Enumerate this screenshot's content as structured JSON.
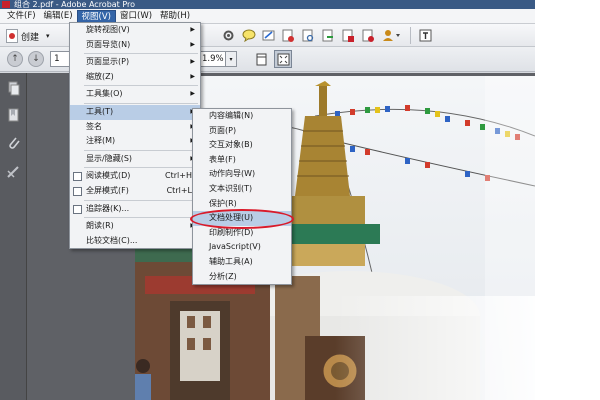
{
  "window": {
    "title": "组合 2.pdf - Adobe Acrobat Pro"
  },
  "menubar": {
    "items": [
      {
        "label": "文件(F)",
        "active": false
      },
      {
        "label": "编辑(E)",
        "active": false
      },
      {
        "label": "视图(V)",
        "active": true
      },
      {
        "label": "窗口(W)",
        "active": false
      },
      {
        "label": "帮助(H)",
        "active": false
      }
    ]
  },
  "toolbar": {
    "create_label": "创建",
    "create_arrow": "▾"
  },
  "navbar": {
    "page_number": "1",
    "zoom_value": "1.9%",
    "zoom_arrow": "▾"
  },
  "view_menu": {
    "items": [
      {
        "label": "旋转视图(V)",
        "submenu": true
      },
      {
        "label": "页面导览(N)",
        "submenu": true
      },
      {
        "sep": true
      },
      {
        "label": "页面显示(P)",
        "submenu": true
      },
      {
        "label": "缩放(Z)",
        "submenu": true
      },
      {
        "sep": true
      },
      {
        "label": "工具集(O)",
        "submenu": true
      },
      {
        "sep": true
      },
      {
        "label": "工具(T)",
        "submenu": true,
        "highlight": true
      },
      {
        "label": "签名",
        "submenu": true
      },
      {
        "label": "注释(M)",
        "submenu": true
      },
      {
        "sep": true
      },
      {
        "label": "显示/隐藏(S)",
        "submenu": true
      },
      {
        "sep": true
      },
      {
        "label": "阅读模式(D)",
        "shortcut": "Ctrl+H",
        "icon": true
      },
      {
        "label": "全屏模式(F)",
        "shortcut": "Ctrl+L",
        "icon": true
      },
      {
        "sep": true
      },
      {
        "label": "追踪器(K)...",
        "icon": true
      },
      {
        "sep": true
      },
      {
        "label": "朗读(R)",
        "submenu": true
      },
      {
        "label": "比较文档(C)..."
      }
    ]
  },
  "tools_submenu": {
    "items": [
      {
        "label": "内容编辑(N)"
      },
      {
        "label": "页面(P)"
      },
      {
        "label": "交互对象(B)"
      },
      {
        "label": "表单(F)"
      },
      {
        "label": "动作向导(W)"
      },
      {
        "label": "文本识别(T)"
      },
      {
        "label": "保护(R)"
      },
      {
        "label": "文档处理(U)",
        "highlight": true,
        "circled": true
      },
      {
        "label": "印刷制作(D)"
      },
      {
        "label": "JavaScript(V)"
      },
      {
        "label": "辅助工具(A)"
      },
      {
        "label": "分析(Z)"
      }
    ]
  },
  "colors": {
    "menu_highlight": "#b9cde6",
    "menubar_active": "#3465a8",
    "annotation_red": "#d91a2a"
  }
}
